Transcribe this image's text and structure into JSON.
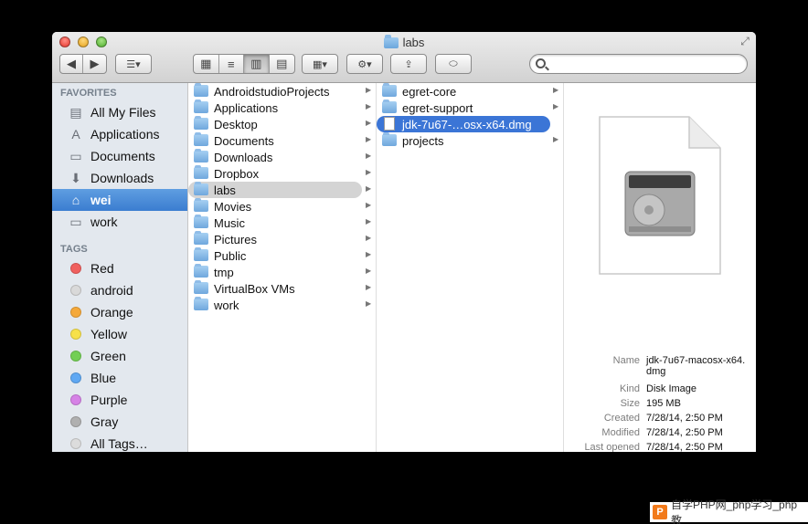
{
  "window": {
    "title": "labs"
  },
  "search": {
    "placeholder": ""
  },
  "sidebar": {
    "favorites_header": "FAVORITES",
    "favorites": [
      {
        "label": "All My Files",
        "icon": "all-files-icon"
      },
      {
        "label": "Applications",
        "icon": "applications-icon"
      },
      {
        "label": "Documents",
        "icon": "documents-icon"
      },
      {
        "label": "Downloads",
        "icon": "downloads-icon"
      },
      {
        "label": "wei",
        "icon": "home-icon",
        "selected": true
      },
      {
        "label": "work",
        "icon": "folder-icon"
      }
    ],
    "tags_header": "TAGS",
    "tags": [
      {
        "label": "Red",
        "color": "#f0605e"
      },
      {
        "label": "android",
        "color": "#d9d9d9"
      },
      {
        "label": "Orange",
        "color": "#f5a93a"
      },
      {
        "label": "Yellow",
        "color": "#f7e14a"
      },
      {
        "label": "Green",
        "color": "#72cf54"
      },
      {
        "label": "Blue",
        "color": "#5fa8f3"
      },
      {
        "label": "Purple",
        "color": "#d682e6"
      },
      {
        "label": "Gray",
        "color": "#b0b0b0"
      },
      {
        "label": "All Tags…",
        "color": "#dcdcdc"
      }
    ]
  },
  "column1": {
    "items": [
      "AndroidstudioProjects",
      "Applications",
      "Desktop",
      "Documents",
      "Downloads",
      "Dropbox",
      "labs",
      "Movies",
      "Music",
      "Pictures",
      "Public",
      "tmp",
      "VirtualBox VMs",
      "work"
    ],
    "selected_index": 6
  },
  "column2": {
    "items": [
      {
        "name": "egret-core",
        "type": "folder"
      },
      {
        "name": "egret-support",
        "type": "folder"
      },
      {
        "name": "jdk-7u67-…osx-x64.dmg",
        "type": "file",
        "selected": true
      },
      {
        "name": "projects",
        "type": "folder"
      }
    ]
  },
  "preview": {
    "info": [
      {
        "key": "Name",
        "value": "jdk-7u67-macosx-x64.dmg"
      },
      {
        "key": "Kind",
        "value": "Disk Image"
      },
      {
        "key": "Size",
        "value": "195 MB"
      },
      {
        "key": "Created",
        "value": "7/28/14, 2:50 PM"
      },
      {
        "key": "Modified",
        "value": "7/28/14, 2:50 PM"
      },
      {
        "key": "Last opened",
        "value": "7/28/14, 2:50 PM"
      }
    ]
  },
  "watermark": {
    "logo": "P",
    "text": "自学PHP网_php学习_php教"
  },
  "colors": {
    "selection_blue": "#3b75d6",
    "sidebar_bg": "#e3e8ee"
  }
}
